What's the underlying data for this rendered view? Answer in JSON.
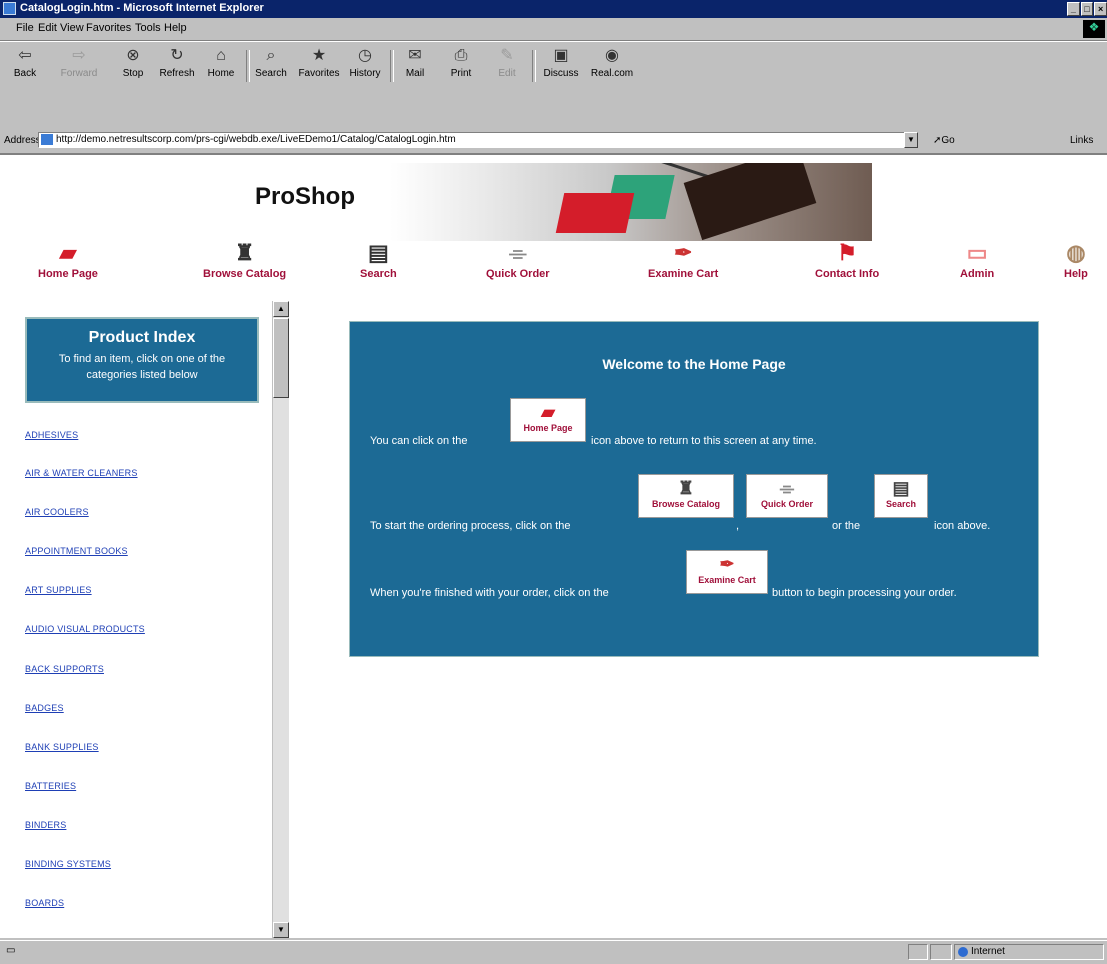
{
  "window": {
    "title": "CatalogLogin.htm - Microsoft Internet Explorer",
    "buttons": [
      "_",
      "□",
      "×"
    ]
  },
  "menu": {
    "items": [
      "File",
      "Edit",
      "View",
      "Favorites",
      "Tools",
      "Help"
    ]
  },
  "toolbar": {
    "buttons": [
      {
        "label": "Back",
        "icon": "back-arrow-icon",
        "glyph": "⇦"
      },
      {
        "label": "Forward",
        "icon": "forward-arrow-icon",
        "glyph": "⇨"
      },
      {
        "label": "Stop",
        "icon": "stop-icon",
        "glyph": "⊗"
      },
      {
        "label": "Refresh",
        "icon": "refresh-icon",
        "glyph": "↻"
      },
      {
        "label": "Home",
        "icon": "home-icon",
        "glyph": "⌂"
      },
      {
        "label": "Search",
        "icon": "search-icon",
        "glyph": "⌕"
      },
      {
        "label": "Favorites",
        "icon": "favorites-icon",
        "glyph": "★"
      },
      {
        "label": "History",
        "icon": "history-icon",
        "glyph": "◷"
      },
      {
        "label": "Mail",
        "icon": "mail-icon",
        "glyph": "✉"
      },
      {
        "label": "Print",
        "icon": "print-icon",
        "glyph": "⎙"
      },
      {
        "label": "Edit",
        "icon": "edit-icon",
        "glyph": "✎"
      },
      {
        "label": "Discuss",
        "icon": "discuss-icon",
        "glyph": "▣"
      },
      {
        "label": "Real.com",
        "icon": "realcom-icon",
        "glyph": "◉"
      }
    ]
  },
  "address": {
    "label": "Address",
    "url": "http://demo.netresultscorp.com/prs-cgi/webdb.exe/LiveEDemo1/Catalog/CatalogLogin.htm",
    "go_label": "Go",
    "links_label": "Links"
  },
  "page": {
    "brand": "ProShop",
    "nav": [
      {
        "label": "Home Page",
        "icon": "home-page-icon",
        "glyph": "▰"
      },
      {
        "label": "Browse Catalog",
        "icon": "stamp-icon",
        "glyph": "♜"
      },
      {
        "label": "Search",
        "icon": "floppy-disk-icon",
        "glyph": "▤"
      },
      {
        "label": "Quick Order",
        "icon": "paperclip-icon",
        "glyph": "⌯"
      },
      {
        "label": "Examine Cart",
        "icon": "pen-icon",
        "glyph": "✒"
      },
      {
        "label": "Contact Info",
        "icon": "pushpin-icon",
        "glyph": "⚑"
      },
      {
        "label": "Admin",
        "icon": "eraser-icon",
        "glyph": "▭"
      },
      {
        "label": "Help",
        "icon": "tape-icon",
        "glyph": "◍"
      }
    ],
    "product_index": {
      "title": "Product Index",
      "subtitle": "To find an item, click on one of the categories listed below"
    },
    "categories": [
      "ADHESIVES",
      "AIR & WATER CLEANERS",
      "AIR COOLERS",
      "APPOINTMENT BOOKS",
      "ART SUPPLIES",
      "AUDIO VISUAL PRODUCTS",
      "BACK SUPPORTS",
      "BADGES",
      "BANK SUPPLIES",
      "BATTERIES",
      "BINDERS",
      "BINDING SYSTEMS",
      "BOARDS"
    ],
    "welcome": {
      "title": "Welcome to the Home Page",
      "line1_pre": "You can click on the",
      "line1_chip": "Home Page",
      "line1_post": "icon above to return to this screen at any time.",
      "line2_pre": "To start the ordering process, click on the",
      "line2_chip1": "Browse Catalog",
      "line2_comma": ",",
      "line2_chip2": "Quick Order",
      "line2_or": "or the",
      "line2_chip3": "Search",
      "line2_post": "icon above.",
      "line3_pre": "When you're finished with your order, click on the",
      "line3_chip": "Examine Cart",
      "line3_post": "button to begin processing your order."
    }
  },
  "status": {
    "zone": "Internet"
  },
  "colors": {
    "panel": "#1c6a95",
    "nav_text": "#a0103a",
    "link": "#1e3fb5",
    "titlebar": "#0a246a"
  }
}
